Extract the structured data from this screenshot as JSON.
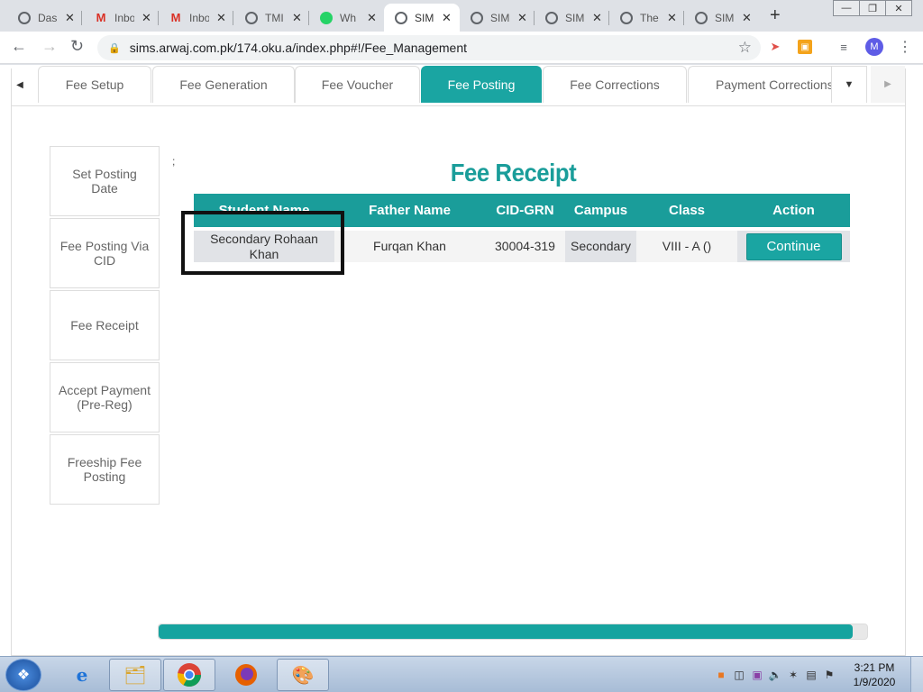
{
  "browser": {
    "tabs": [
      {
        "title": "Das",
        "icon": "globe-icon"
      },
      {
        "title": "Inbo",
        "icon": "gmail-icon"
      },
      {
        "title": "Inbo",
        "icon": "gmail-icon"
      },
      {
        "title": "TMI",
        "icon": "globe-icon"
      },
      {
        "title": "Wh",
        "icon": "whatsapp-icon"
      },
      {
        "title": "SIM",
        "icon": "globe-icon",
        "active": true
      },
      {
        "title": "SIM",
        "icon": "globe-icon"
      },
      {
        "title": "SIM",
        "icon": "globe-icon"
      },
      {
        "title": "The",
        "icon": "globe-icon"
      },
      {
        "title": "SIM",
        "icon": "globe-icon"
      }
    ],
    "close_glyph": "✕",
    "new_tab_glyph": "+",
    "url": "sims.arwaj.com.pk/174.oku.a/index.php#!/Fee_Management",
    "avatar_initial": "M"
  },
  "module_tabs": [
    "Fee Setup",
    "Fee Generation",
    "Fee Voucher",
    "Fee Posting",
    "Fee Corrections",
    "Payment Corrections"
  ],
  "active_module_tab": "Fee Posting",
  "side_nav": [
    "Set Posting Date",
    "Fee Posting Via CID",
    "Fee Receipt",
    "Accept Payment (Pre-Reg)",
    "Freeship Fee Posting"
  ],
  "stray_text": ";",
  "receipt": {
    "title": "Fee Receipt",
    "columns": [
      "Student Name",
      "Father Name",
      "CID-GRN",
      "Campus",
      "Class",
      "Action"
    ],
    "rows": [
      {
        "student_name": "Secondary Rohaan Khan",
        "father_name": "Furqan Khan",
        "cid_grn": "30004-319",
        "campus": "Secondary",
        "class": "VIII - A ()",
        "action_label": "Continue"
      }
    ]
  },
  "progress": {
    "fraction": 0.98,
    "color": "#16a39f"
  },
  "accent_color": "#1a9d9a",
  "taskbar": {
    "apps": [
      "internet-explorer-icon",
      "file-explorer-icon",
      "chrome-icon",
      "firefox-icon",
      "paint-icon"
    ],
    "clock_time": "3:21 PM",
    "clock_date": "1/9/2020"
  }
}
